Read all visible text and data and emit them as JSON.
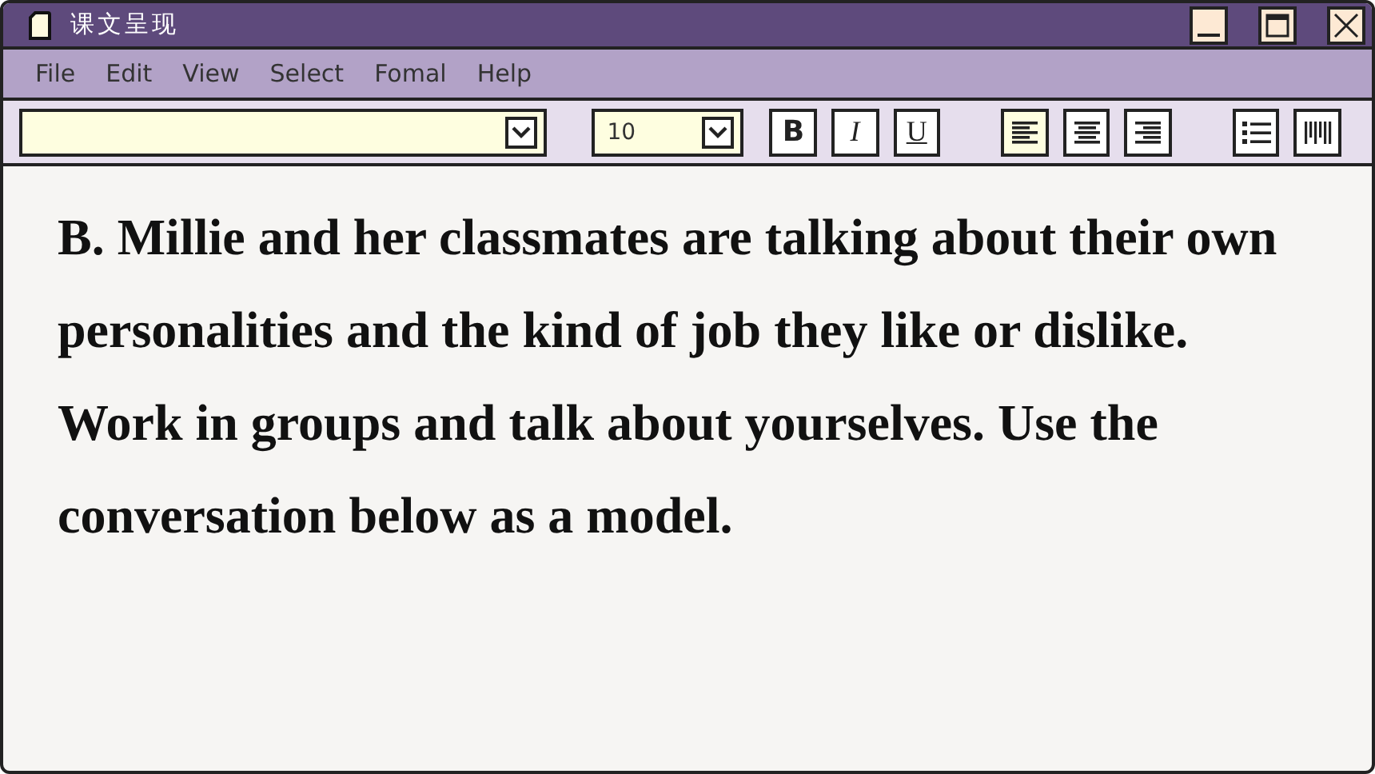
{
  "window": {
    "title": "课文呈现"
  },
  "menu": [
    "File",
    "Edit",
    "View",
    "Select",
    "Fomal",
    "Help"
  ],
  "toolbar": {
    "font_size": "10",
    "styles": [
      {
        "label": "B",
        "kind": "bold"
      },
      {
        "label": "I",
        "kind": "italic"
      },
      {
        "label": "U",
        "kind": "underline"
      }
    ],
    "alignment": [
      {
        "kind": "left",
        "selected": true
      },
      {
        "kind": "center",
        "selected": false
      },
      {
        "kind": "right",
        "selected": false
      }
    ]
  },
  "document": {
    "text": "B. Millie and her classmates are talking about their own personalities and the kind of job they like or dislike. Work in groups and talk about yourselves. Use the conversation below as a model."
  }
}
